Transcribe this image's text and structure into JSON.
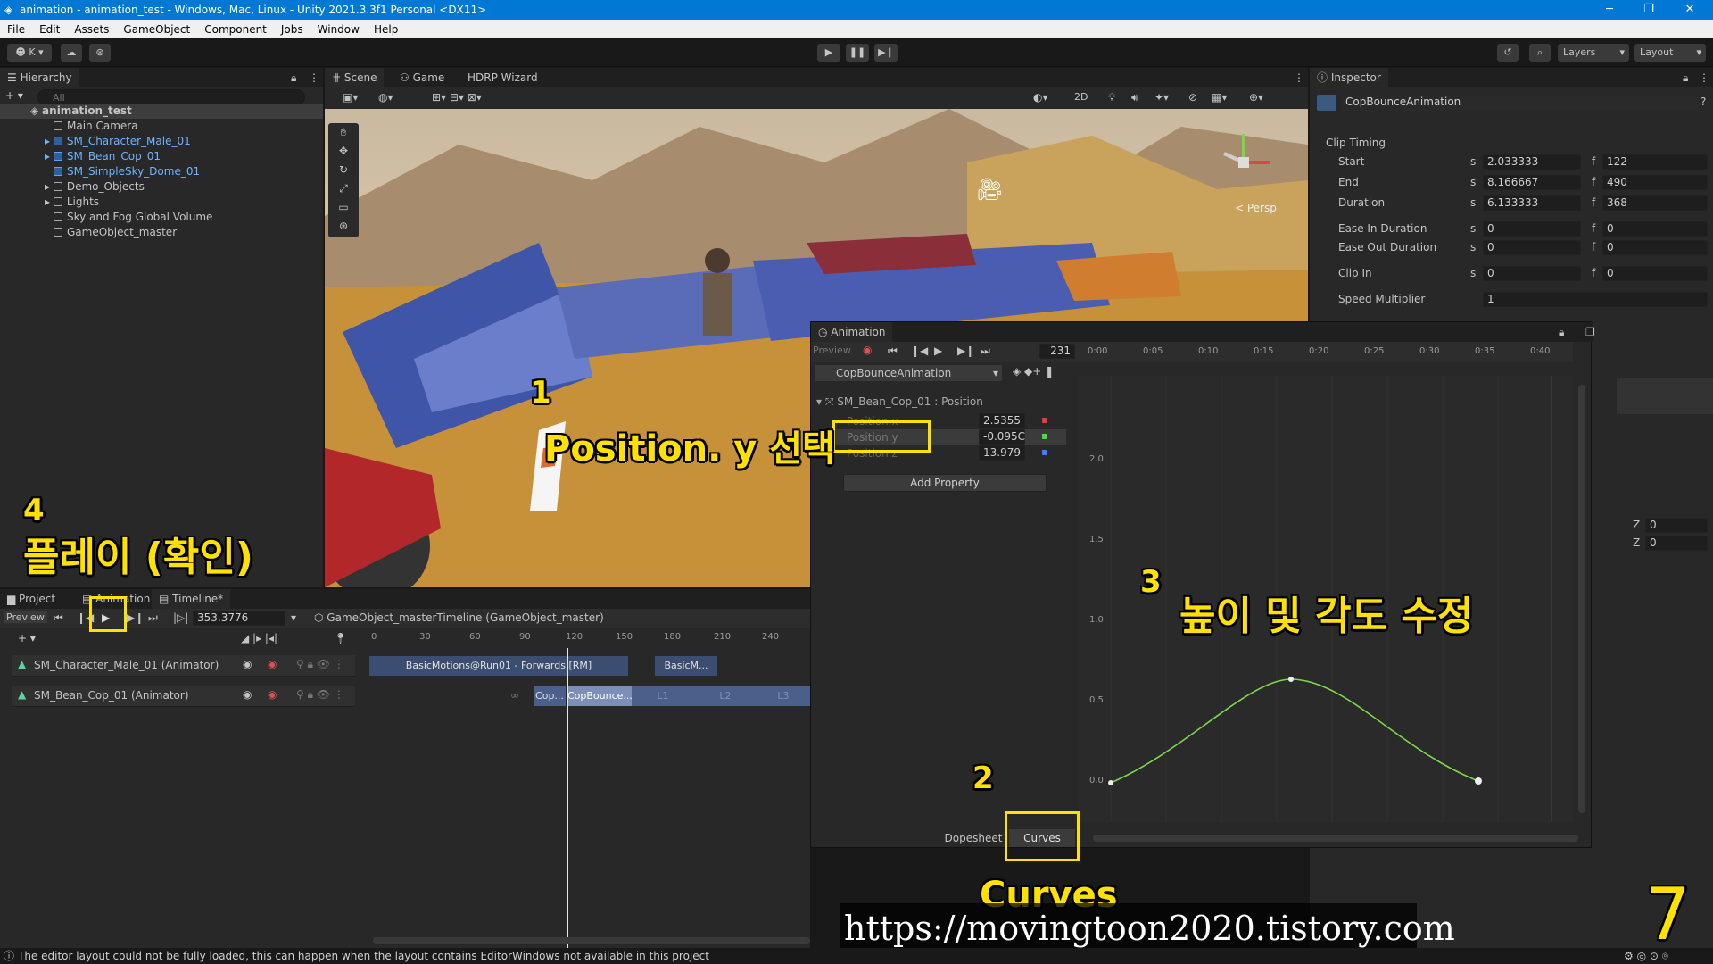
{
  "window": {
    "title": "animation - animation_test - Windows, Mac, Linux - Unity 2021.3.3f1 Personal <DX11>",
    "minimize": "─",
    "restore": "❐",
    "close": "✕"
  },
  "menu": [
    "File",
    "Edit",
    "Assets",
    "GameObject",
    "Component",
    "Jobs",
    "Window",
    "Help"
  ],
  "toolbar": {
    "account": "K",
    "layers": "Layers",
    "layout": "Layout"
  },
  "hierarchy": {
    "tab": "Hierarchy",
    "search_placeholder": "All",
    "root": "animation_test",
    "items": [
      {
        "label": "Main Camera",
        "prefab": false
      },
      {
        "label": "SM_Character_Male_01",
        "prefab": true
      },
      {
        "label": "SM_Bean_Cop_01",
        "prefab": true
      },
      {
        "label": "SM_SimpleSky_Dome_01",
        "prefab": true
      },
      {
        "label": "Demo_Objects",
        "prefab": false
      },
      {
        "label": "Lights",
        "prefab": false
      },
      {
        "label": "Sky and Fog Global Volume",
        "prefab": false
      },
      {
        "label": "GameObject_master",
        "prefab": false
      }
    ]
  },
  "scene": {
    "tabs": [
      "Scene",
      "Game",
      "HDRP Wizard"
    ],
    "toolbar_2d": "2D",
    "persp": "< Persp"
  },
  "inspector": {
    "tab": "Inspector",
    "object": "CopBounceAnimation",
    "section": "Clip Timing",
    "rows": [
      {
        "label": "Start",
        "s": "2.033333",
        "f": "122"
      },
      {
        "label": "End",
        "s": "8.166667",
        "f": "490"
      },
      {
        "label": "Duration",
        "s": "6.133333",
        "f": "368"
      },
      {
        "label": "Ease In Duration",
        "s": "0",
        "f": "0"
      },
      {
        "label": "Ease Out Duration",
        "s": "0",
        "f": "0"
      },
      {
        "label": "Clip In",
        "s": "0",
        "f": "0"
      }
    ],
    "speed_label": "Speed Multiplier",
    "speed_value": "1",
    "s": "s",
    "f": "f",
    "z_label": "Z",
    "z1": "0",
    "z2": "0"
  },
  "animation": {
    "tab": "Animation",
    "preview": "Preview",
    "frame": "231",
    "clip": "CopBounceAnimation",
    "property_group": "SM_Bean_Cop_01 : Position",
    "props": [
      {
        "label": "Position.x",
        "value": "2.5355"
      },
      {
        "label": "Position.y",
        "value": "-0.095C"
      },
      {
        "label": "Position.z",
        "value": "13.979"
      }
    ],
    "add_property": "Add Property",
    "dopesheet": "Dopesheet",
    "curves": "Curves",
    "ruler": [
      "0:00",
      "0:05",
      "0:10",
      "0:15",
      "0:20",
      "0:25",
      "0:30",
      "0:35",
      "0:40"
    ],
    "y_labels": [
      "2.0",
      "1.5",
      "1.0",
      "0.5",
      "0.0"
    ]
  },
  "timeline": {
    "tabs": [
      "Project",
      "Animation",
      "Timeline*"
    ],
    "preview": "Preview",
    "time": "353.3776",
    "director": "GameObject_masterTimeline (GameObject_master)",
    "ruler": [
      "0",
      "30",
      "60",
      "90",
      "120",
      "150",
      "180",
      "210",
      "240"
    ],
    "tracks": [
      {
        "label": "SM_Character_Male_01 (Animator)",
        "clips": [
          "BasicMotions@Run01 - Forwards [RM]",
          "BasicM..."
        ]
      },
      {
        "label": "SM_Bean_Cop_01 (Animator)",
        "clips": [
          "Cop...",
          "CopBounce...",
          "L1",
          "L2",
          "L3"
        ]
      }
    ]
  },
  "annotations": {
    "n1": "1",
    "t1": "Position. y 선택",
    "n2": "2",
    "t2": "Curves",
    "n3": "3",
    "t3": "높이 및 각도 수정",
    "n4": "4",
    "t4": "플레이 (확인)",
    "page": "7",
    "url": "https://movingtoon2020.tistory.com"
  },
  "status": "The editor layout could not be fully loaded, this can happen when the layout contains EditorWindows not available in this project"
}
